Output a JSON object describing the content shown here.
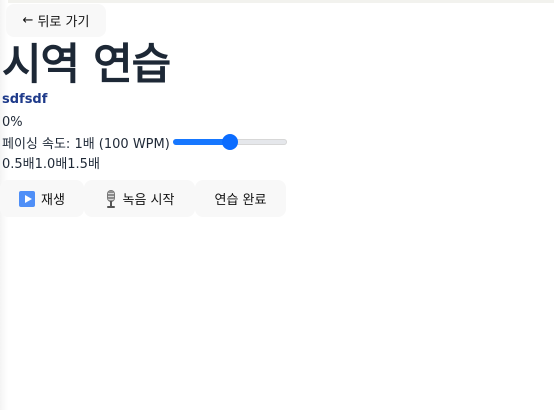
{
  "header": {
    "back_label": "뒤로 가기",
    "back_icon": "arrow-left-icon"
  },
  "page": {
    "title": "시역 연습",
    "subtitle": "sdfsdf",
    "progress_text": "0%"
  },
  "speed": {
    "label": "페이싱 속도: 1배 (100 WPM)",
    "fraction": 0.5,
    "min_label": "0.5배",
    "mid_label": "1.0배",
    "max_label": "1.5배",
    "accent_color": "#1677ff"
  },
  "controls": {
    "play_label": "재생",
    "play_icon": "play-icon",
    "record_label": "녹음 시작",
    "record_icon": "microphone-icon",
    "finish_label": "연습 완료"
  }
}
